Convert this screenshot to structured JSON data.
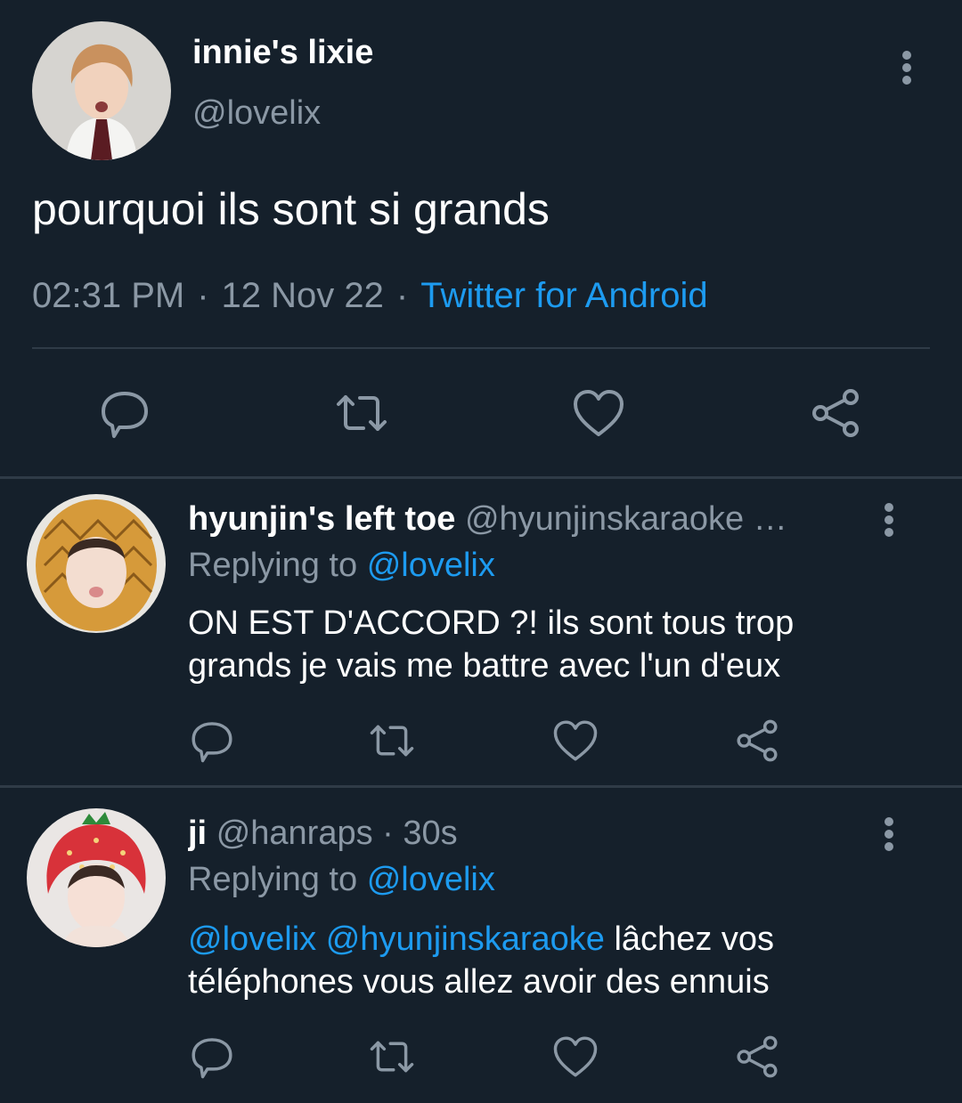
{
  "main_tweet": {
    "display_name": "innie's lixie",
    "handle": "@lovelix",
    "text": "pourquoi ils sont si grands",
    "time": "02:31 PM",
    "separator": "·",
    "date": "12 Nov 22",
    "source": "Twitter for Android",
    "actions": [
      "reply-icon",
      "retweet-icon",
      "like-icon",
      "share-icon"
    ]
  },
  "replies": [
    {
      "display_name": "hyunjin's left toe",
      "handle": "@hyunjinskaraoke …",
      "replying_prefix": "Replying to",
      "replying_to": "@lovelix",
      "text": "ON EST D'ACCORD ?! ils sont tous trop grands je vais me battre avec l'un d'eux"
    },
    {
      "display_name": "ji",
      "handle": "@hanraps",
      "separator": "·",
      "time": "30s",
      "replying_prefix": "Replying to",
      "replying_to": "@lovelix",
      "mention_1": "@lovelix",
      "mention_2": "@hyunjinskaraoke",
      "text": "lâchez vos téléphones vous allez avoir des ennuis"
    }
  ],
  "colors": {
    "background": "#15202b",
    "text_primary": "#ffffff",
    "text_secondary": "#8b98a5",
    "accent": "#1d9bf0",
    "divider": "#2f3b47"
  }
}
